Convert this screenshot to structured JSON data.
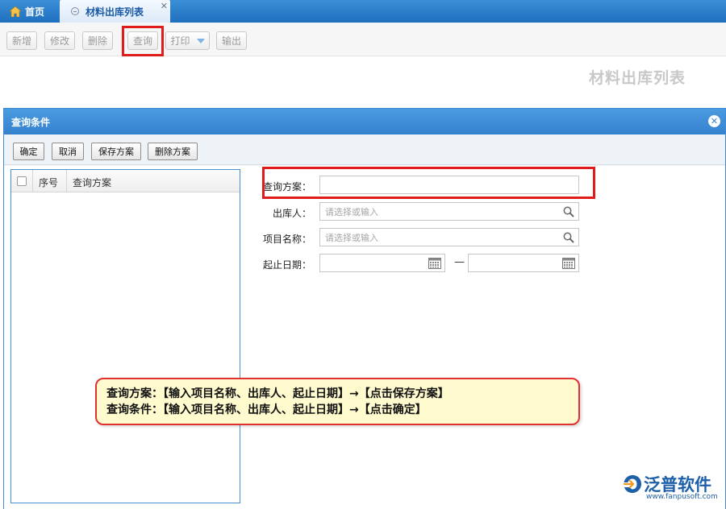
{
  "tabs": {
    "home_label": "首页",
    "active_label": "材料出库列表",
    "close_glyph": "✕"
  },
  "toolbar": {
    "add_label": "新增",
    "edit_label": "修改",
    "delete_label": "删除",
    "query_label": "查询",
    "print_label": "打印",
    "export_label": "输出"
  },
  "page": {
    "title": "材料出库列表"
  },
  "dialog": {
    "title": "查询条件",
    "close_glyph": "✕",
    "buttons": {
      "confirm": "确定",
      "cancel": "取消",
      "save_plan": "保存方案",
      "delete_plan": "删除方案"
    },
    "list": {
      "col_index": "序号",
      "col_plan": "查询方案"
    },
    "form": {
      "plan_label": "查询方案：",
      "plan_value": "",
      "issuer_label": "出库人：",
      "issuer_placeholder": "请选择或输入",
      "project_label": "项目名称：",
      "project_placeholder": "请选择或输入",
      "date_label": "起止日期：",
      "date_separator": "—",
      "date_start": "",
      "date_end": ""
    }
  },
  "annotation": {
    "line1": "查询方案：【输入项目名称、出库人、起止日期】→【点击保存方案】",
    "line2": "查询条件：【输入项目名称、出库人、起止日期】→【点击确定】"
  },
  "logo": {
    "name": "泛普软件",
    "url": "www.fanpusoft.com"
  },
  "colors": {
    "accent_blue": "#3581cf",
    "highlight_red": "#e01b1b",
    "note_fill": "#fffbcf"
  }
}
